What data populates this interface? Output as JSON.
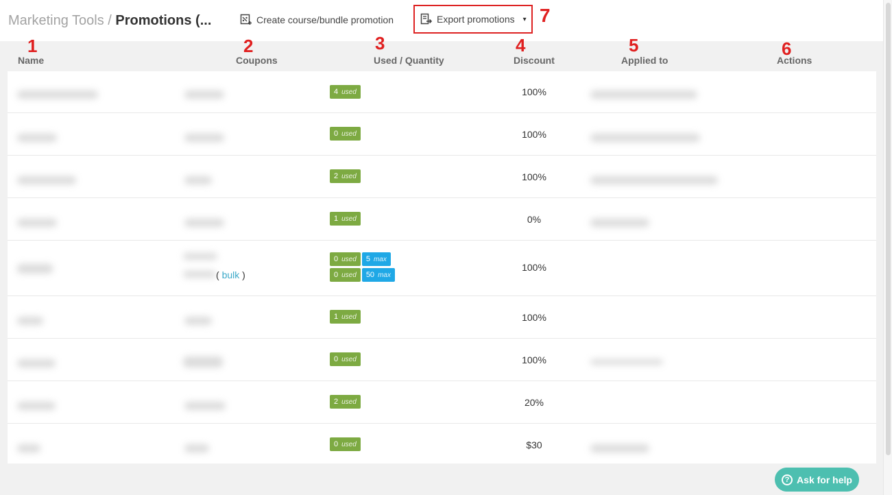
{
  "header": {
    "breadcrumb_parent": "Marketing Tools",
    "breadcrumb_separator": " / ",
    "breadcrumb_current": "Promotions (...",
    "create_label": "Create course/bundle promotion",
    "export_label": "Export promotions",
    "caret": "▾"
  },
  "annotations": [
    "1",
    "2",
    "3",
    "4",
    "5",
    "6",
    "7"
  ],
  "columns": [
    "Name",
    "Coupons",
    "Used / Quantity",
    "Discount",
    "Applied to",
    "Actions"
  ],
  "rows": [
    {
      "used": "4",
      "discount": "100%"
    },
    {
      "used": "0",
      "discount": "100%"
    },
    {
      "used": "2",
      "discount": "100%"
    },
    {
      "used": "1",
      "discount": "0%"
    },
    {
      "used": "0",
      "max": "5",
      "used2": "0",
      "max2": "50",
      "discount": "100%",
      "bulk_open": "( ",
      "bulk_link": "bulk",
      "bulk_close": " )"
    },
    {
      "used": "1",
      "discount": "100%"
    },
    {
      "used": "0",
      "discount": "100%"
    },
    {
      "used": "2",
      "discount": "20%"
    },
    {
      "used": "0",
      "discount": "$30"
    }
  ],
  "badge_used_label": "used",
  "badge_max_label": "max",
  "help_label": "Ask for help",
  "help_icon_glyph": "?",
  "colors": {
    "used_badge": "#7daa42",
    "max_badge": "#1fa8e6",
    "help_button": "#4dbfb0",
    "annotation": "#e02020",
    "bulk_link": "#3aa8c8"
  }
}
